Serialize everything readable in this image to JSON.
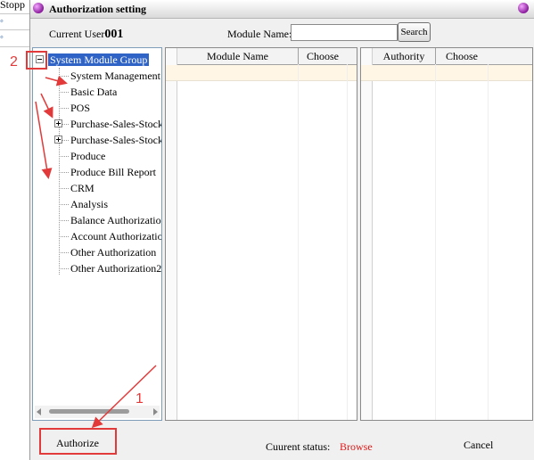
{
  "background": {
    "truncated_label": "Stopp"
  },
  "dialog": {
    "title": "Authorization setting"
  },
  "header": {
    "current_user_label": "Current User",
    "current_user_value": "001",
    "module_name_label": "Module Name:",
    "module_name_value": "",
    "search_label": "Search"
  },
  "tree": {
    "root_label": "System Module Group",
    "items": [
      {
        "label": "System Management",
        "expandable": false
      },
      {
        "label": "Basic Data",
        "expandable": false
      },
      {
        "label": "POS",
        "expandable": false
      },
      {
        "label": "Purchase-Sales-Stock",
        "expandable": true
      },
      {
        "label": "Purchase-Sales-Stock",
        "expandable": true
      },
      {
        "label": "Produce",
        "expandable": false
      },
      {
        "label": "Produce Bill Report",
        "expandable": false
      },
      {
        "label": "CRM",
        "expandable": false
      },
      {
        "label": "Analysis",
        "expandable": false
      },
      {
        "label": "Balance Authorization",
        "expandable": false
      },
      {
        "label": "Account Authorization",
        "expandable": false
      },
      {
        "label": "Other Authorization",
        "expandable": false
      },
      {
        "label": "Other Authorization2",
        "expandable": false
      }
    ]
  },
  "module_grid": {
    "columns": [
      "Module Name",
      "Choose"
    ]
  },
  "authority_grid": {
    "columns": [
      "Authority",
      "Choose"
    ]
  },
  "footer": {
    "authorize_label": "Authorize",
    "status_label": "Cuurent status:",
    "status_value": "Browse",
    "cancel_label": "Cancel"
  },
  "annotations": {
    "step1": "1",
    "step2": "2",
    "color": "#e23a3a"
  },
  "colors": {
    "selection": "#3063c6",
    "status_value": "#e01919"
  }
}
